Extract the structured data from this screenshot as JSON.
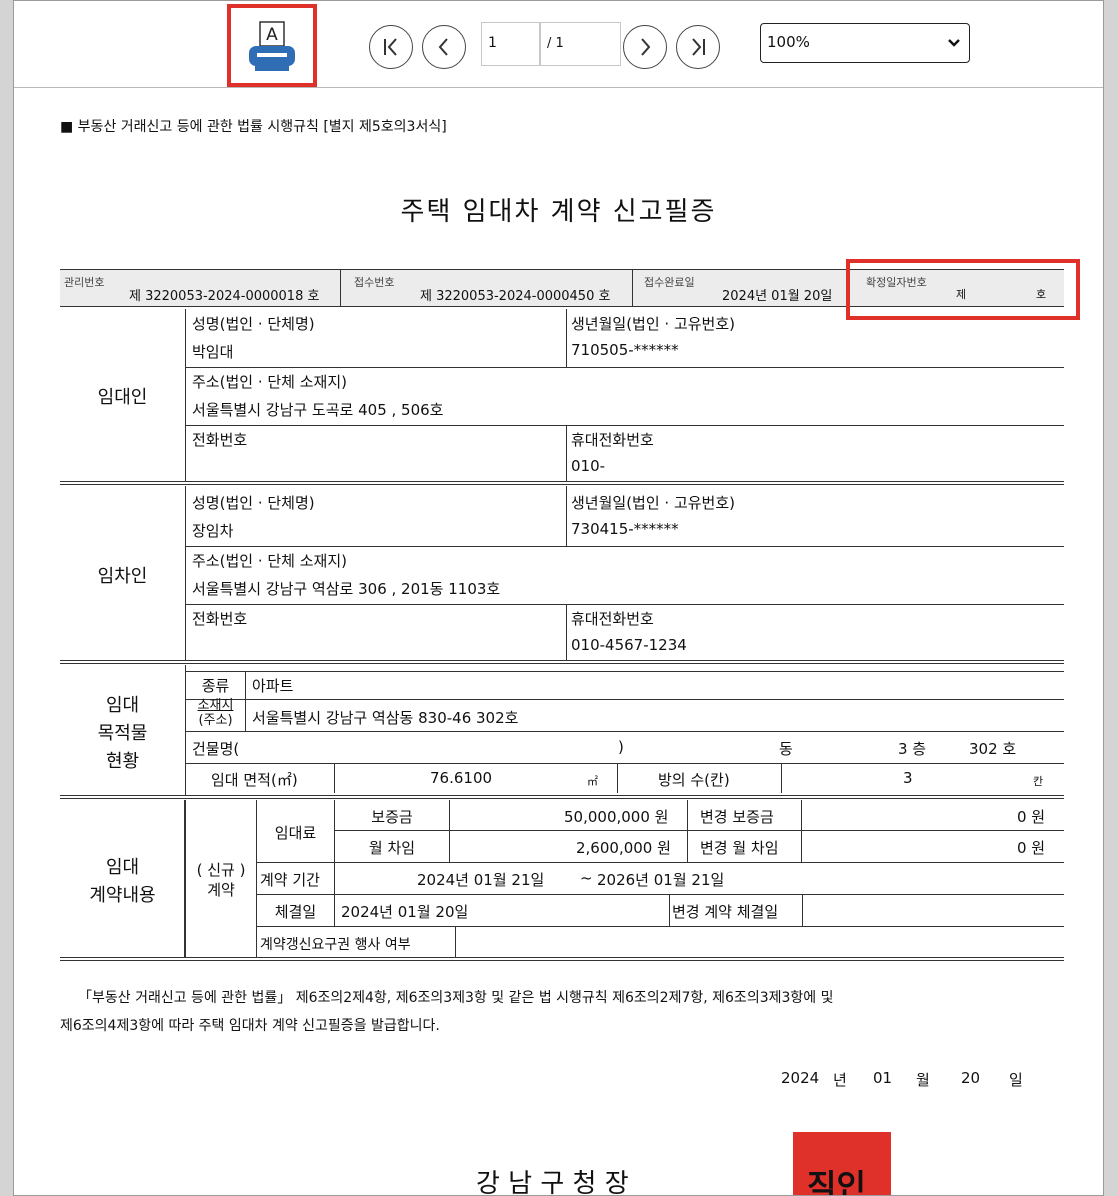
{
  "toolbar": {
    "page_current": "1",
    "page_total": "/ 1",
    "zoom": "100%",
    "zoom_options": [
      "100%"
    ]
  },
  "doc": {
    "header_note": "■ 부동산 거래신고 등에 관한 법률 시행규칙 [별지 제5호의3서식]",
    "title": "주택 임대차 계약 신고필증",
    "info": {
      "mgmt_label": "관리번호",
      "mgmt_value": "제 3220053-2024-0000018 호",
      "receipt_label": "접수번호",
      "receipt_value": "제 3220053-2024-0000450 호",
      "done_label": "접수완료일",
      "done_value": "2024년 01월 20일",
      "confirm_label": "확정일자번호",
      "confirm_prefix": "제",
      "confirm_suffix": "호"
    },
    "lessor": {
      "label": "임대인",
      "name_label": "성명(법인 · 단체명)",
      "name": "박임대",
      "birth_label": "생년월일(법인 · 고유번호)",
      "birth": "710505-******",
      "addr_label": "주소(법인 · 단체 소재지)",
      "addr": "서울특별시 강남구 도곡로 405 , 506호",
      "tel_label": "전화번호",
      "tel": "",
      "mobile_label": "휴대전화번호",
      "mobile": "010-"
    },
    "lessee": {
      "label": "임차인",
      "name_label": "성명(법인 · 단체명)",
      "name": "장임차",
      "birth_label": "생년월일(법인 · 고유번호)",
      "birth": "730415-******",
      "addr_label": "주소(법인 · 단체 소재지)",
      "addr": "서울특별시 강남구 역삼로 306 , 201동 1103호",
      "tel_label": "전화번호",
      "tel": "",
      "mobile_label": "휴대전화번호",
      "mobile": "010-4567-1234"
    },
    "property": {
      "label_1": "임대",
      "label_2": "목적물",
      "label_3": "현황",
      "type_label": "종류",
      "type_value": "아파트",
      "loc_label_1": "소재지",
      "loc_label_2": "(주소)",
      "loc_value": "서울특별시 강남구 역삼동 830-46 302호",
      "bldg_label": "건물명(",
      "bldg_close": ")",
      "dong_label": "동",
      "floor": "3 층",
      "ho": "302 호",
      "area_label": "임대 면적(㎡)",
      "area_value": "76.6100",
      "area_unit": "㎡",
      "rooms_label": "방의 수(칸)",
      "rooms_value": "3",
      "rooms_unit": "칸"
    },
    "contract": {
      "label_1": "임대",
      "label_2": "계약내용",
      "kind_1": "( 신규 )",
      "kind_2": "계약",
      "rent_label": "임대료",
      "deposit_label": "보증금",
      "deposit_value": "50,000,000 원",
      "chg_deposit_label": "변경 보증금",
      "chg_deposit_value": "0 원",
      "monthly_label": "월 차임",
      "monthly_value": "2,600,000 원",
      "chg_monthly_label": "변경 월 차임",
      "chg_monthly_value": "0 원",
      "period_label": "계약 기간",
      "period_start": "2024년 01월 21일",
      "period_sep": "~",
      "period_end": "2026년 01월 21일",
      "signed_label": "체결일",
      "signed_value": "2024년 01월 20일",
      "chg_signed_label": "변경 계약 체결일",
      "chg_signed_value": "",
      "renewal_label": "계약갱신요구권 행사 여부",
      "renewal_value": ""
    },
    "legal_1": "「부동산 거래신고 등에 관한 법률」 제6조의2제4항, 제6조의3제3항 및 같은 법 시행규칙 제6조의2제7항, 제6조의3제3항에 및",
    "legal_2": "제6조의4제3항에 따라 주택 임대차 계약 신고필증을 발급합니다.",
    "date_year": "2024",
    "date_year_unit": "년",
    "date_month": "01",
    "date_month_unit": "월",
    "date_day": "20",
    "date_day_unit": "일",
    "issuer": "강 남 구 청 장",
    "seal": "직인"
  },
  "colors": {
    "highlight": "#e0302a",
    "seal": "#e0302a",
    "printer_blue": "#2f6db5"
  }
}
